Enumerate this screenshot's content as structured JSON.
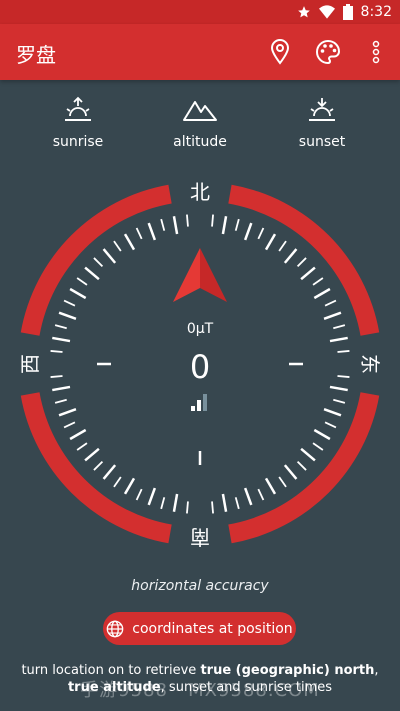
{
  "status_bar": {
    "time": "8:32",
    "icons": [
      "star-icon",
      "wifi-icon",
      "battery-icon"
    ]
  },
  "app_bar": {
    "title": "罗盘",
    "actions": [
      "location-pin-icon",
      "palette-icon",
      "more-vert-icon"
    ]
  },
  "features": [
    {
      "label": "sunrise",
      "icon": "sunrise-icon"
    },
    {
      "label": "altitude",
      "icon": "mountain-icon"
    },
    {
      "label": "sunset",
      "icon": "sunset-icon"
    }
  ],
  "compass": {
    "north": "北",
    "east": "东",
    "south": "南",
    "west": "西",
    "magnetic_field": "0μT",
    "heading": "0"
  },
  "accuracy_label": "horizontal accuracy",
  "coordinates_button": "coordinates at position",
  "info": {
    "part1": "turn location on to retrieve ",
    "bold1": "true (geographic) north",
    "part2": ", ",
    "bold2": "true altitude",
    "part3": ", sunset and sunrise times"
  },
  "watermark": "手游9588 · MX9588.COM",
  "colors": {
    "accent": "#d32f2f",
    "background": "#37474f",
    "status_bar": "#c62828"
  }
}
